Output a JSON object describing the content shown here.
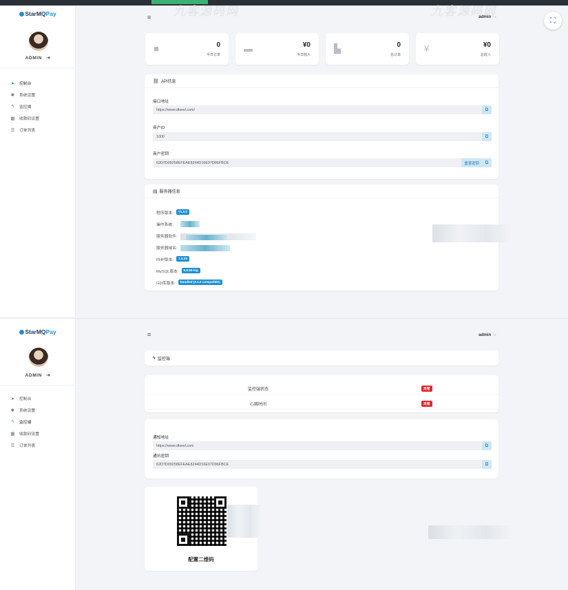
{
  "brand": {
    "prefix": "StarMQ",
    "suffix": "Pay"
  },
  "user": {
    "name": "ADMIN",
    "logout_icon": "logout-icon",
    "menu_label": "admin",
    "menu_chevron": "⌵"
  },
  "watermark": "九客源码网",
  "nav": [
    {
      "label": "控制台",
      "icon": "send-icon"
    },
    {
      "label": "系统设置",
      "icon": "gear-icon"
    },
    {
      "label": "监控端",
      "icon": "bolt-icon"
    },
    {
      "label": "收款码设置",
      "icon": "grid-icon"
    },
    {
      "label": "订单列表",
      "icon": "list-icon"
    }
  ],
  "stats": [
    {
      "value": "0",
      "label": "今日订单",
      "icon": "bag-icon"
    },
    {
      "value": "¥0",
      "label": "今日收入",
      "icon": "wallet-icon"
    },
    {
      "value": "0",
      "label": "总订单",
      "icon": "chart-icon"
    },
    {
      "value": "¥0",
      "label": "总收入",
      "icon": "yen-icon"
    }
  ],
  "api": {
    "title": "API信息",
    "url_label": "接口地址",
    "url_value": "https://www.dkewl.com/",
    "merchant_id_label": "商户ID",
    "merchant_id_value": "1000",
    "merchant_key_label": "商户密钥",
    "merchant_key_value": "62D7D09258EFEAE8244D16E97D96FBCE",
    "reset_label": "重置密钥"
  },
  "server": {
    "title": "服务器信息",
    "program_version_label": "程序版本:",
    "program_version": "V1.0.0",
    "os_label": "操作系统:",
    "software_label": "服务器软件:",
    "domain_label": "服务器域名:",
    "php_label": "PHP版本:",
    "php_version": "7.4.33",
    "mysql_label": "MySQL版本:",
    "mysql_version": "5.6.50-log",
    "gd_label": "GD库版本:",
    "gd_version": "bundled (2.1.0 compatible)"
  },
  "monitor": {
    "title": "监控端",
    "status_label": "监控端状态",
    "status_value": "异常",
    "heartbeat_label": "心跳时间",
    "heartbeat_value": "异常",
    "notify_url_label": "通知地址",
    "notify_url_value": "https://www.dkewl.com",
    "comm_key_label": "通讯密钥",
    "comm_key_value": "62D7D09258EFEAE8244D16E97D96FBCE",
    "qr_caption": "配置二维码"
  }
}
